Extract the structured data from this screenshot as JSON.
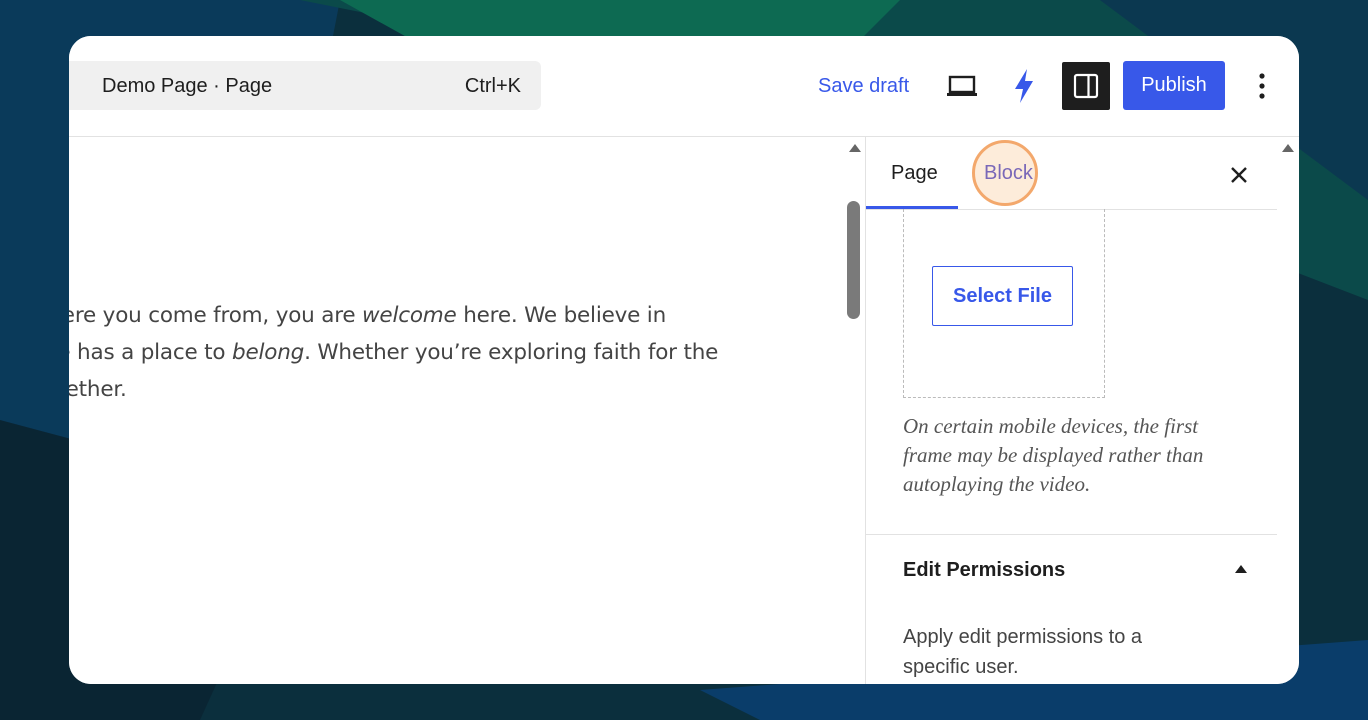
{
  "header": {
    "document_title": "Demo Page · Page",
    "shortcut": "Ctrl+K",
    "save_draft": "Save draft",
    "publish": "Publish"
  },
  "content": {
    "line1_pre": "where you come from, you are ",
    "line1_em": "welcome",
    "line1_post": " here. We believe in",
    "line2_pre": "one has a place to ",
    "line2_em": "belong",
    "line2_post": ". Whether you’re exploring faith for the",
    "line3": "together."
  },
  "sidebar": {
    "tab_page": "Page",
    "tab_block": "Block",
    "select_file": "Select File",
    "note": "On certain mobile devices, the first frame may be displayed rather than autoplaying the video.",
    "permissions_title": "Edit Permissions",
    "permissions_desc": "Apply edit permissions to a specific user."
  },
  "colors": {
    "accent": "#3858e9",
    "highlight": "#f3a86c"
  },
  "icons": [
    "laptop-icon",
    "bolt-icon",
    "sidebar-toggle-icon",
    "more-vertical-icon",
    "close-icon",
    "chevron-up-icon"
  ]
}
